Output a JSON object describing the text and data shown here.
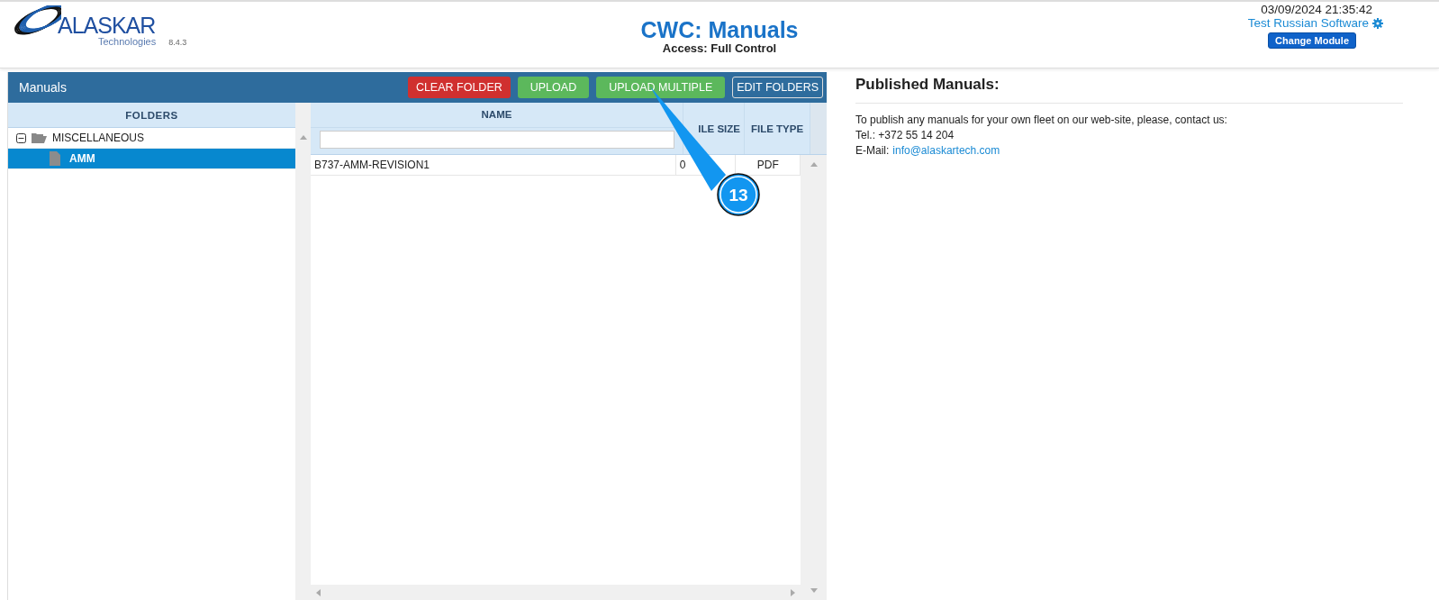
{
  "logo": {
    "name": "ALASKAR",
    "subtitle": "Technologies",
    "version": "8.4.3"
  },
  "header": {
    "title": "CWC: Manuals",
    "access": "Access: Full Control",
    "datetime": "03/09/2024 21:35:42",
    "user": "Test Russian Software",
    "change_module": "Change Module"
  },
  "panel": {
    "title": "Manuals",
    "buttons": [
      {
        "label": "CLEAR FOLDER",
        "kind": "danger"
      },
      {
        "label": "UPLOAD",
        "kind": "success"
      },
      {
        "label": "UPLOAD MULTIPLE",
        "kind": "success"
      },
      {
        "label": "EDIT FOLDERS",
        "kind": "outline"
      }
    ]
  },
  "folders": {
    "heading": "FOLDERS",
    "tree": [
      {
        "label": "MISCELLANEOUS",
        "expanded": true,
        "selected": false,
        "children": [
          {
            "label": "AMM",
            "selected": true
          }
        ]
      }
    ]
  },
  "table": {
    "columns": [
      "NAME",
      "ILE SIZE",
      "FILE TYPE"
    ],
    "rows": [
      [
        "B737-AMM-REVISION1",
        "0",
        "PDF"
      ]
    ]
  },
  "published": {
    "title": "Published Manuals:",
    "text": "To publish any manuals for your own fleet on our web-site, please, contact us:",
    "tel": "Tel.: +372 55 14 204",
    "email_label": "E-Mail:",
    "email": "info@alaskartech.com"
  },
  "callout": {
    "number": "13"
  }
}
